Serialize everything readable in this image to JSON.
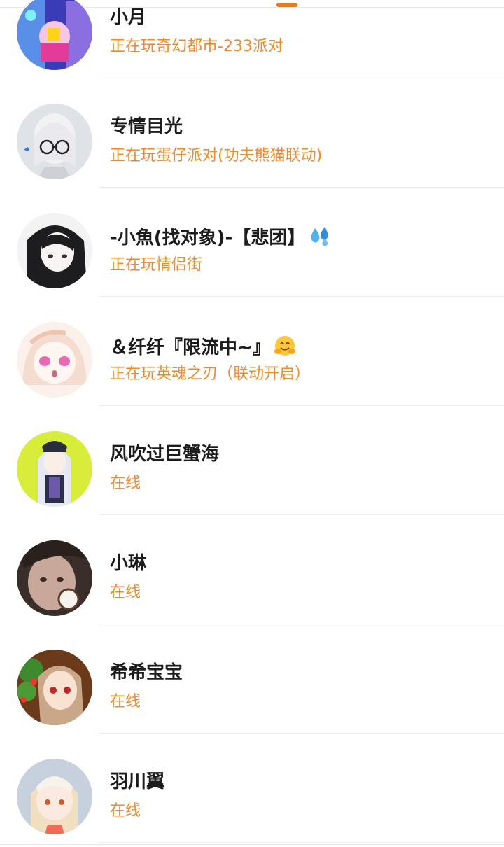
{
  "friends": [
    {
      "name": "小月",
      "status": "正在玩奇幻都市-233派对"
    },
    {
      "name": "专情目光",
      "status": "正在玩蛋仔派对(功夫熊猫联动)"
    },
    {
      "name": "-小魚(找对象)-【悲团】",
      "status": "正在玩情侣街"
    },
    {
      "name": "＆纤纤『限流中~』",
      "status": "正在玩英魂之刃（联动开启）"
    },
    {
      "name": "风吹过巨蟹海",
      "status": "在线"
    },
    {
      "name": "小琳",
      "status": "在线"
    },
    {
      "name": "希希宝宝",
      "status": "在线"
    },
    {
      "name": "羽川翼",
      "status": "在线"
    }
  ],
  "icons": {
    "water_drops_emoji": "sweat-droplets-emoji",
    "hug_emoji": "hugging-face-emoji"
  },
  "colors": {
    "status": "#f08a2a",
    "name": "#1c1c1c",
    "accent": "#f07a12"
  }
}
